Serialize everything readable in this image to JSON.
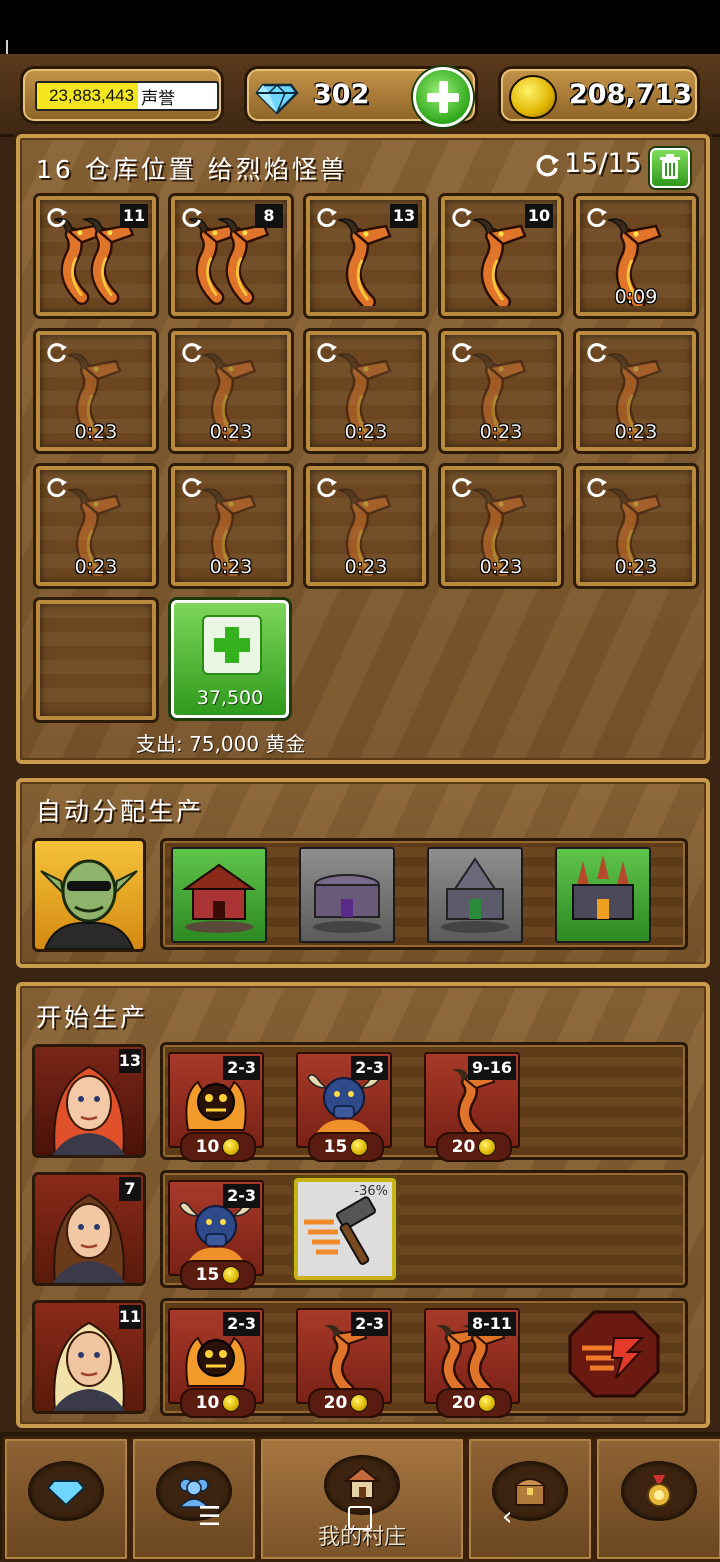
{
  "header": {
    "reputation_value": "23,883,443",
    "reputation_label": "声誉",
    "gems": "302",
    "gold": "208,713"
  },
  "storage": {
    "title": "16 仓库位置 给烈焰怪兽",
    "capacity": "15/15",
    "slots": [
      {
        "count": "11",
        "timer": "",
        "type": "twin-dragon"
      },
      {
        "count": "8",
        "timer": "",
        "type": "twin-dragon"
      },
      {
        "count": "13",
        "timer": "",
        "type": "dragon"
      },
      {
        "count": "10",
        "timer": "",
        "type": "dragon"
      },
      {
        "count": "",
        "timer": "0:09",
        "type": "dragon"
      },
      {
        "count": "",
        "timer": "0:23",
        "type": "dragon-busy"
      },
      {
        "count": "",
        "timer": "0:23",
        "type": "dragon-busy"
      },
      {
        "count": "",
        "timer": "0:23",
        "type": "dragon-busy"
      },
      {
        "count": "",
        "timer": "0:23",
        "type": "dragon-busy"
      },
      {
        "count": "",
        "timer": "0:23",
        "type": "dragon-busy"
      },
      {
        "count": "",
        "timer": "0:23",
        "type": "dragon-busy"
      },
      {
        "count": "",
        "timer": "0:23",
        "type": "dragon-busy"
      },
      {
        "count": "",
        "timer": "0:23",
        "type": "dragon-busy"
      },
      {
        "count": "",
        "timer": "0:23",
        "type": "dragon-busy"
      },
      {
        "count": "",
        "timer": "0:23",
        "type": "dragon-busy"
      }
    ],
    "add_price": "37,500",
    "expense": "支出: 75,000 黄金"
  },
  "auto": {
    "title": "自动分配生产"
  },
  "production": {
    "title": "开始生产",
    "rows": [
      {
        "level": "13",
        "units": [
          {
            "range": "2-3",
            "cost": "10"
          },
          {
            "range": "2-3",
            "cost": "15"
          },
          {
            "range": "9-16",
            "cost": "20"
          }
        ]
      },
      {
        "level": "7",
        "units": [
          {
            "range": "2-3",
            "cost": "15"
          }
        ],
        "boost": "-36%"
      },
      {
        "level": "11",
        "units": [
          {
            "range": "2-3",
            "cost": "10"
          },
          {
            "range": "2-3",
            "cost": "20"
          },
          {
            "range": "8-11",
            "cost": "20"
          }
        ]
      }
    ]
  },
  "nav": {
    "village_label": "我的村庄"
  },
  "colors": {
    "wood": "#7a552b",
    "frame": "#c99b4c",
    "accent_green": "#2f9a1c",
    "unit_red": "#a83a2a"
  }
}
